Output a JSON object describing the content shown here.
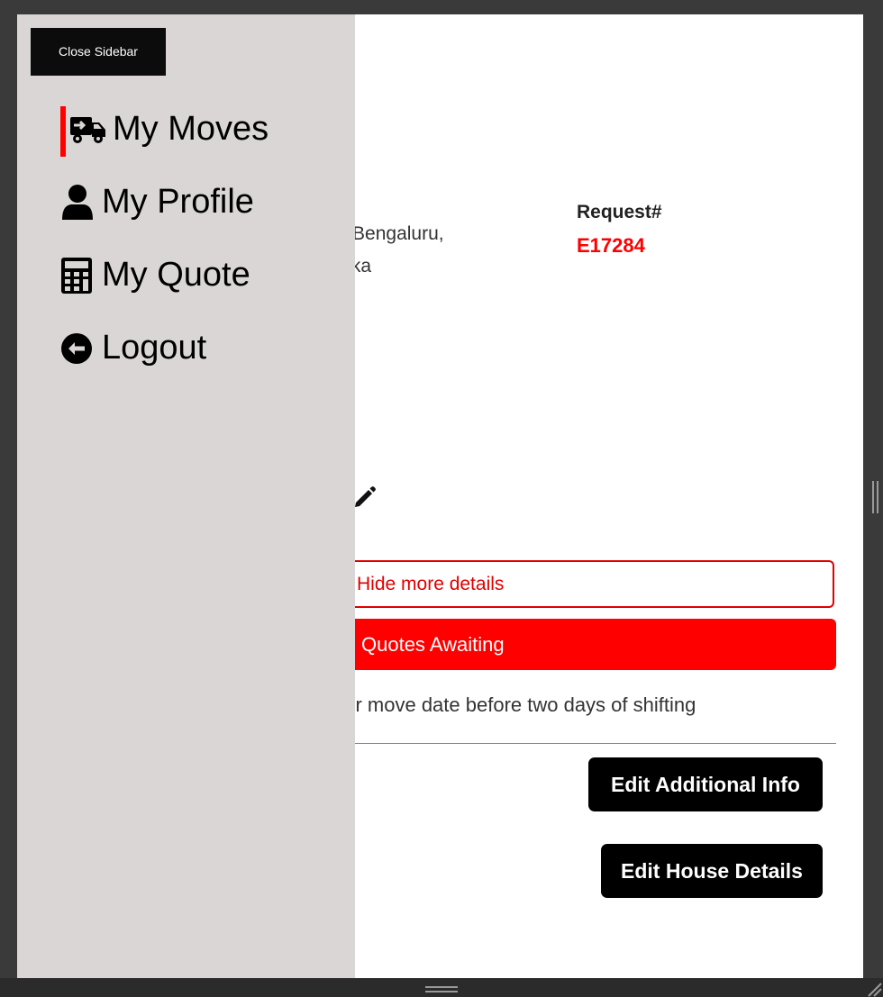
{
  "sidebar": {
    "close_label": "Close Sidebar",
    "items": [
      {
        "label": "My Moves",
        "icon": "truck-moving-icon",
        "active": true
      },
      {
        "label": "My Profile",
        "icon": "user-icon"
      },
      {
        "label": "My Quote",
        "icon": "calculator-icon"
      },
      {
        "label": "Logout",
        "icon": "arrow-circle-left-icon"
      }
    ]
  },
  "main": {
    "address_line1": "ura, Bengaluru,",
    "address_line2": "nataka",
    "request_label": "Request#",
    "request_id": "E17284",
    "hide_details_label": "Hide more details",
    "quotes_awaiting_label": "Quotes Awaiting",
    "move_date_note": "your move date before two days of shifting",
    "edit_additional_info_label": "Edit Additional Info",
    "edit_house_details_label": "Edit House Details"
  },
  "colors": {
    "accent": "#ff0000",
    "sidebar_bg": "#d9d6d5",
    "button_dark": "#000000"
  }
}
